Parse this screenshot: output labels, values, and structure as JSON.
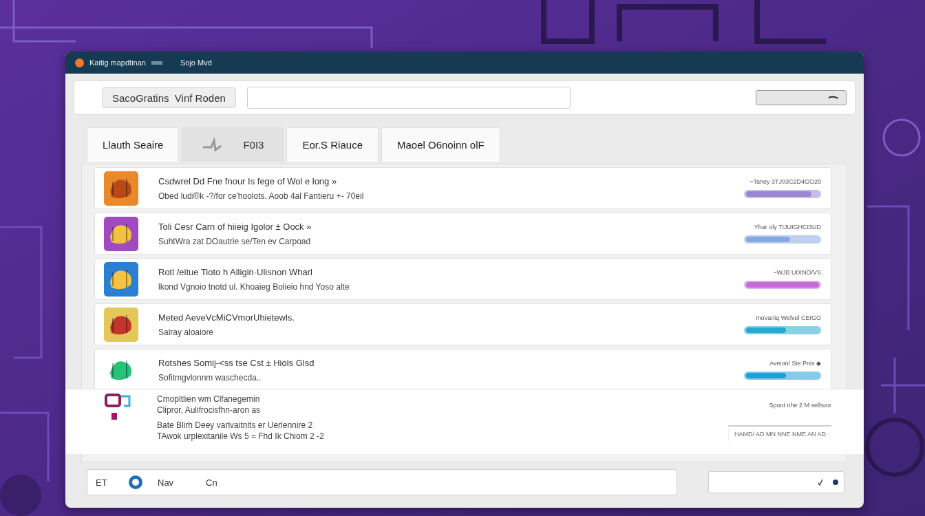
{
  "window": {
    "title": "Kaitig mapdtinan",
    "menu_item": "Sojo Mvd"
  },
  "toolbar": {
    "button": "SacoGratins  Vinf Roden"
  },
  "tabs": [
    {
      "label": "Llauth Seaire",
      "selected": false,
      "kind": "text"
    },
    {
      "label": "F0I3",
      "selected": true,
      "kind": "icon"
    },
    {
      "label": "Eor.S Riauce",
      "selected": false,
      "kind": "text"
    },
    {
      "label": "Maoel O6noinn olF",
      "selected": false,
      "kind": "text"
    }
  ],
  "items": [
    {
      "title": "Csdwrel Dd Fne fnour Is fege of Wol e long  »",
      "subtitle": "Obed ludi®k -?/for ce'hoolots. Aoob     4al  Fantieru +- 70eil",
      "status": "~Taney 3TJ03C2D4GO20",
      "level": 0.9,
      "color": "#9a86d6"
    },
    {
      "title": "Toli Cesr Carn of hiieig Igolor  ±  Oock  »",
      "subtitle": "SuhtWra zat DOautrie se/Ten  ev Carpoad",
      "status": "Yhar oly TIJUIGHCI3UD",
      "level": 0.6,
      "color": "#86a7e0"
    },
    {
      "title": "Rotl /eitue Tioto h Alligin·Ulisnon Wharl",
      "subtitle": "lkond Vgnoio  tnotd ul. Khoaieg Bolieio hnd Yoso alte",
      "status": "~WJB UIXNO/VS",
      "level": 1,
      "color": "#c66ad8"
    },
    {
      "title": "Meted AeveVcMiCVmorUhietewls.",
      "subtitle": "Salray aloaiore",
      "status": "movaniq Welvel CEIGO",
      "level": 0.55,
      "color": "#25a9d0"
    },
    {
      "title": "Rotshes Somij-<ss tse Cst  ±  Hiols Glsd",
      "subtitle": "Sofitmgvlonnm waschecda..",
      "status": "Aveion/ Sie Pnis ◆",
      "level": 0.55,
      "color": "#1d9fd8"
    }
  ],
  "overlay": {
    "items": [
      {
        "title": "Cmopltlien wm Clfanegemin",
        "subtitle": "Clipror, Aulifrocisfhn-aron as"
      },
      {
        "title": "Bate Blirh Deey varlvaitnlts er Uerlennire 2",
        "subtitle": "TAwok urplexitanile Ws 5 = Fhd Ik Chiom 2 -2"
      }
    ],
    "status": "Spoot nhe 2 M selhoor",
    "note": "HAMD/ AD MN NNE NME AN AD"
  },
  "footer": {
    "label": "ET",
    "radio": {
      "label": "Nav",
      "selected": true
    },
    "link": "Cn"
  }
}
